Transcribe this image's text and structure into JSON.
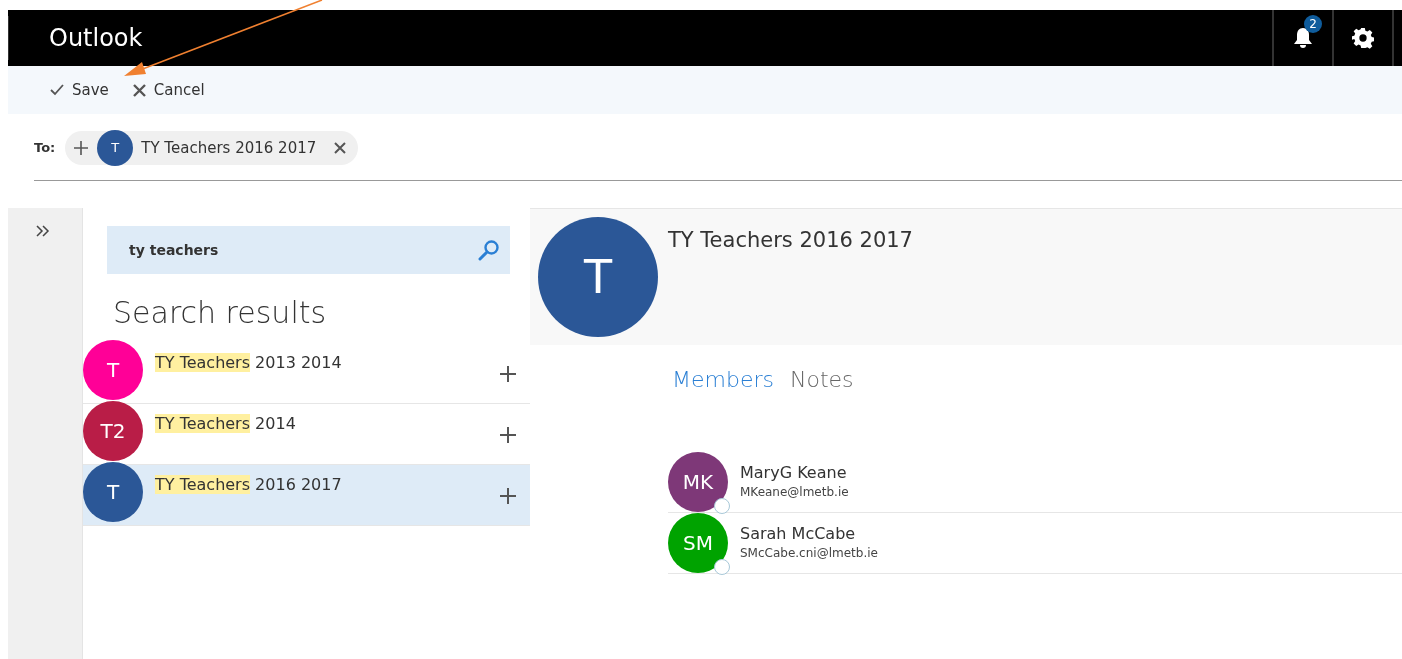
{
  "app": {
    "title": "Outlook",
    "notification_count": "2"
  },
  "toolbar": [
    {
      "kind": "save",
      "label": "Save"
    },
    {
      "kind": "cancel",
      "label": "Cancel"
    }
  ],
  "to_field": {
    "label": "To:",
    "recipient": {
      "initial": "T",
      "name": "TY Teachers 2016 2017",
      "color": "#2b5797"
    }
  },
  "search": {
    "value": "ty teachers",
    "heading": "Search results"
  },
  "results": [
    {
      "initials": "T",
      "color": "#ff0097",
      "highlighted": "TY Teachers",
      "rest": " 2013 2014",
      "selected": false
    },
    {
      "initials": "T2",
      "color": "#b91d47",
      "highlighted": "TY Teachers",
      "rest": " 2014",
      "selected": false
    },
    {
      "initials": "T",
      "color": "#2b5797",
      "highlighted": "TY Teachers",
      "rest": " 2016 2017",
      "selected": true
    }
  ],
  "detail": {
    "initial": "T",
    "color": "#2b5797",
    "name": "TY Teachers 2016 2017",
    "tabs": [
      {
        "label": "Members",
        "selected": true
      },
      {
        "label": "Notes",
        "selected": false
      }
    ],
    "members": [
      {
        "initials": "MK",
        "color": "#7e3878",
        "name": "MaryG Keane",
        "email": "MKeane@lmetb.ie"
      },
      {
        "initials": "SM",
        "color": "#00a300",
        "name": "Sarah McCabe",
        "email": "SMcCabe.cni@lmetb.ie"
      }
    ]
  }
}
